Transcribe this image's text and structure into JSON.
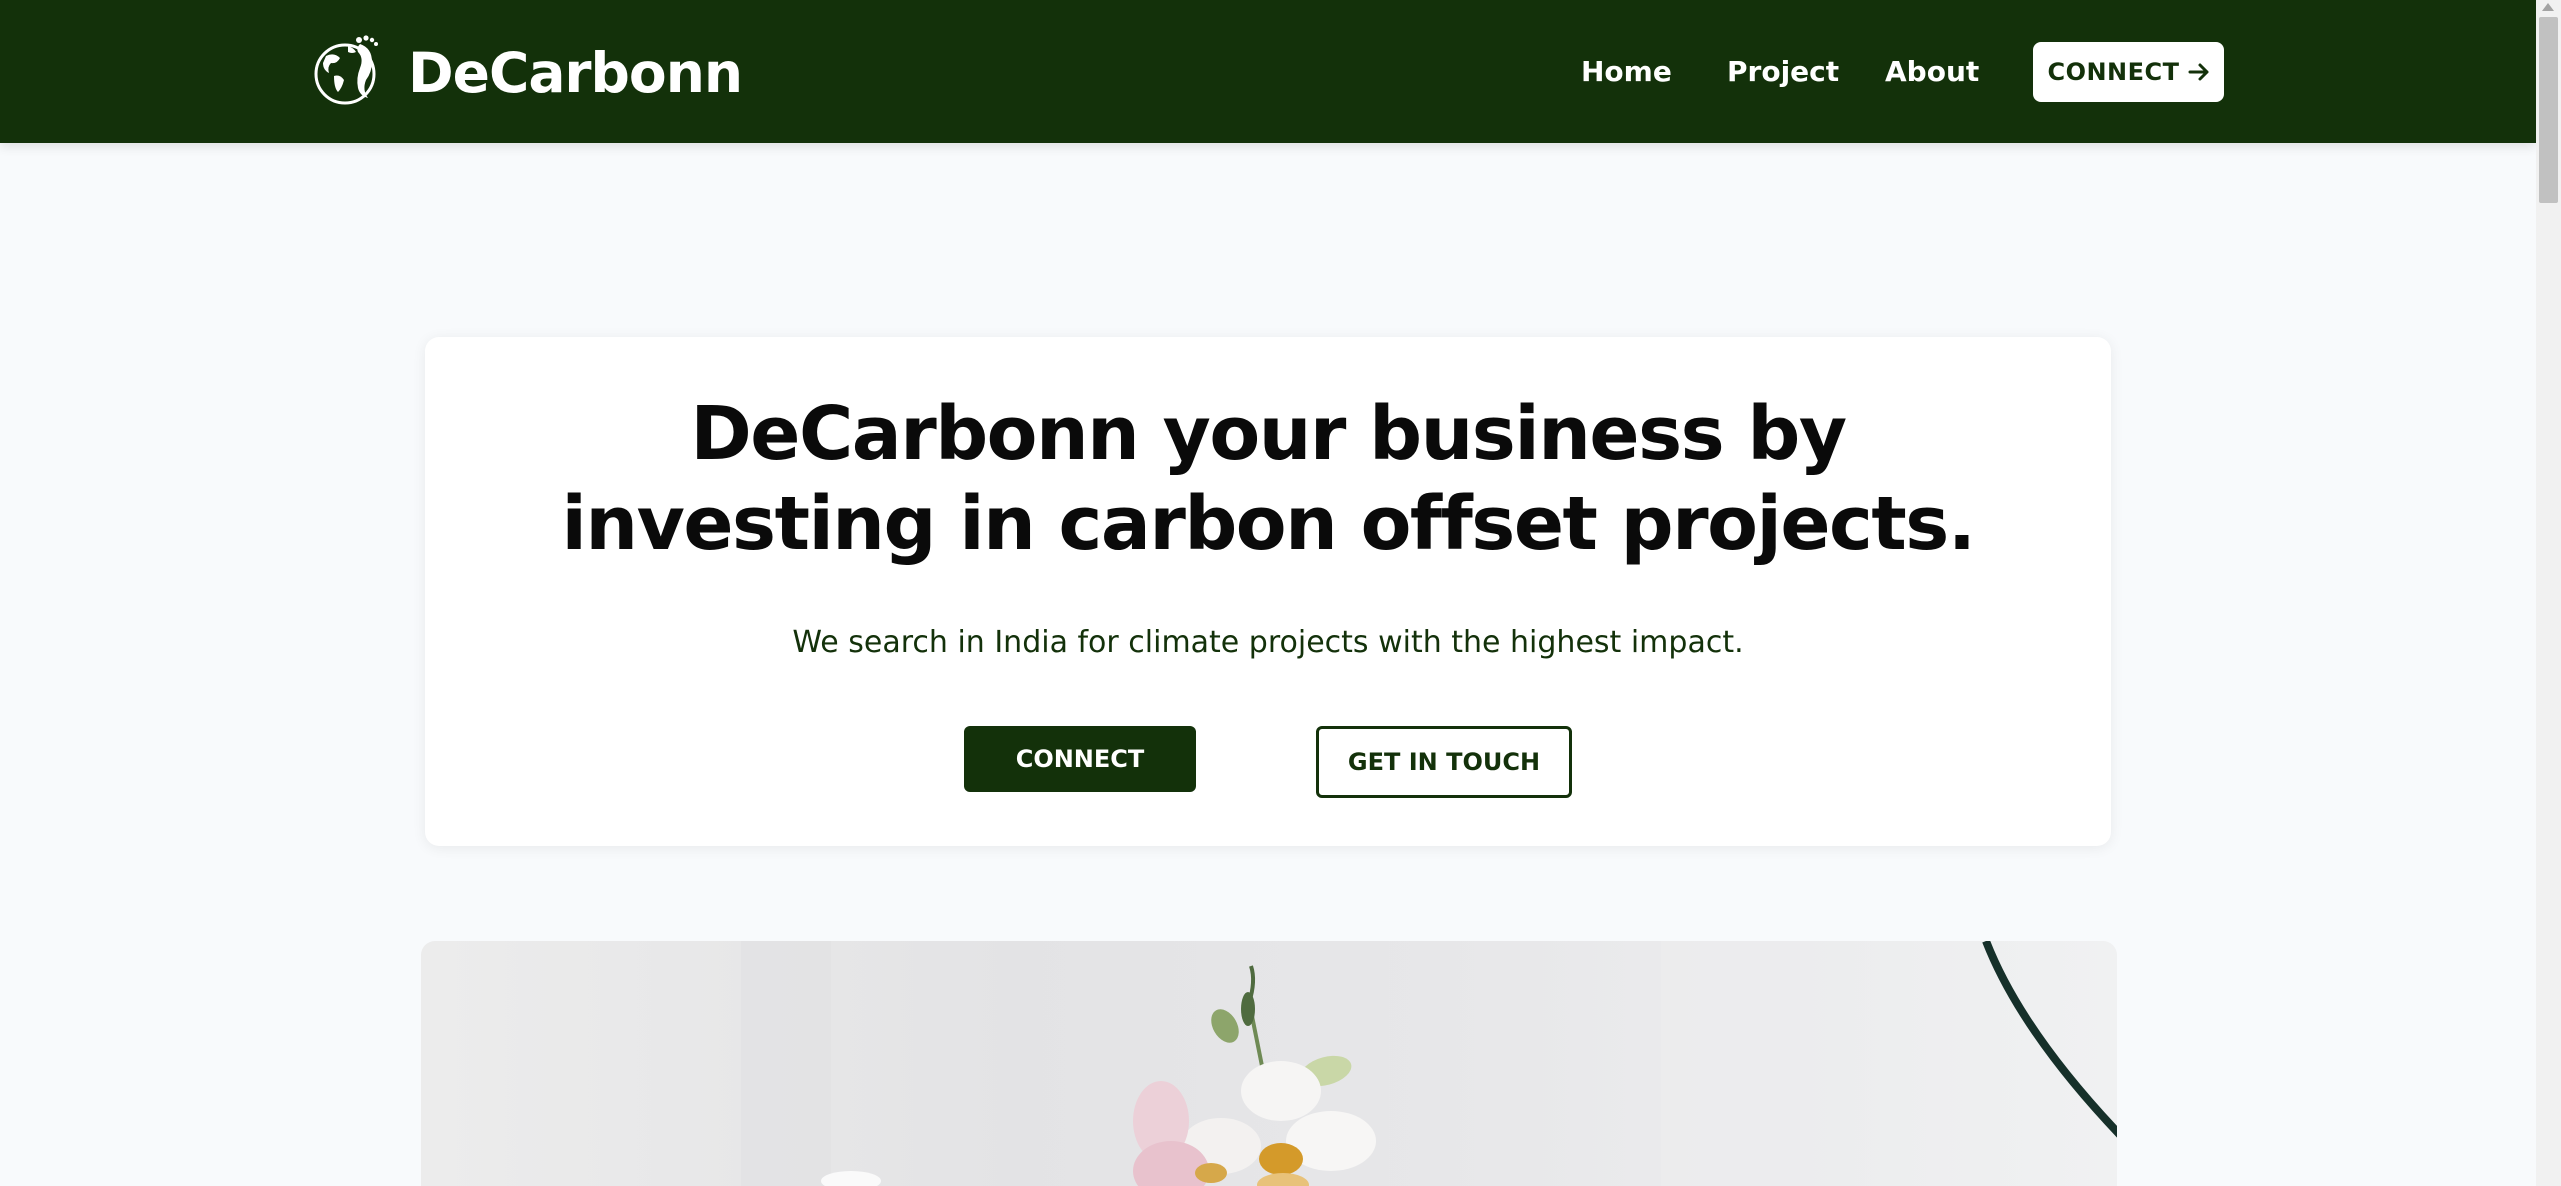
{
  "brand": {
    "name": "DeCarbonn",
    "logo_icon": "earth-footprint-icon"
  },
  "nav": {
    "links": [
      "Home",
      "Project",
      "About"
    ],
    "cta_label": "CONNECT",
    "cta_icon": "arrow-right-icon"
  },
  "hero": {
    "title_line1": "DeCarbonn your business by",
    "title_line2": "investing in carbon offset projects.",
    "subtitle": "We search in India for climate projects with the highest impact.",
    "primary_button": "CONNECT",
    "secondary_button": "GET IN TOUCH"
  },
  "colors": {
    "brand_dark_green": "#13310a",
    "page_background": "#f8fafc",
    "card_background": "#ffffff"
  }
}
